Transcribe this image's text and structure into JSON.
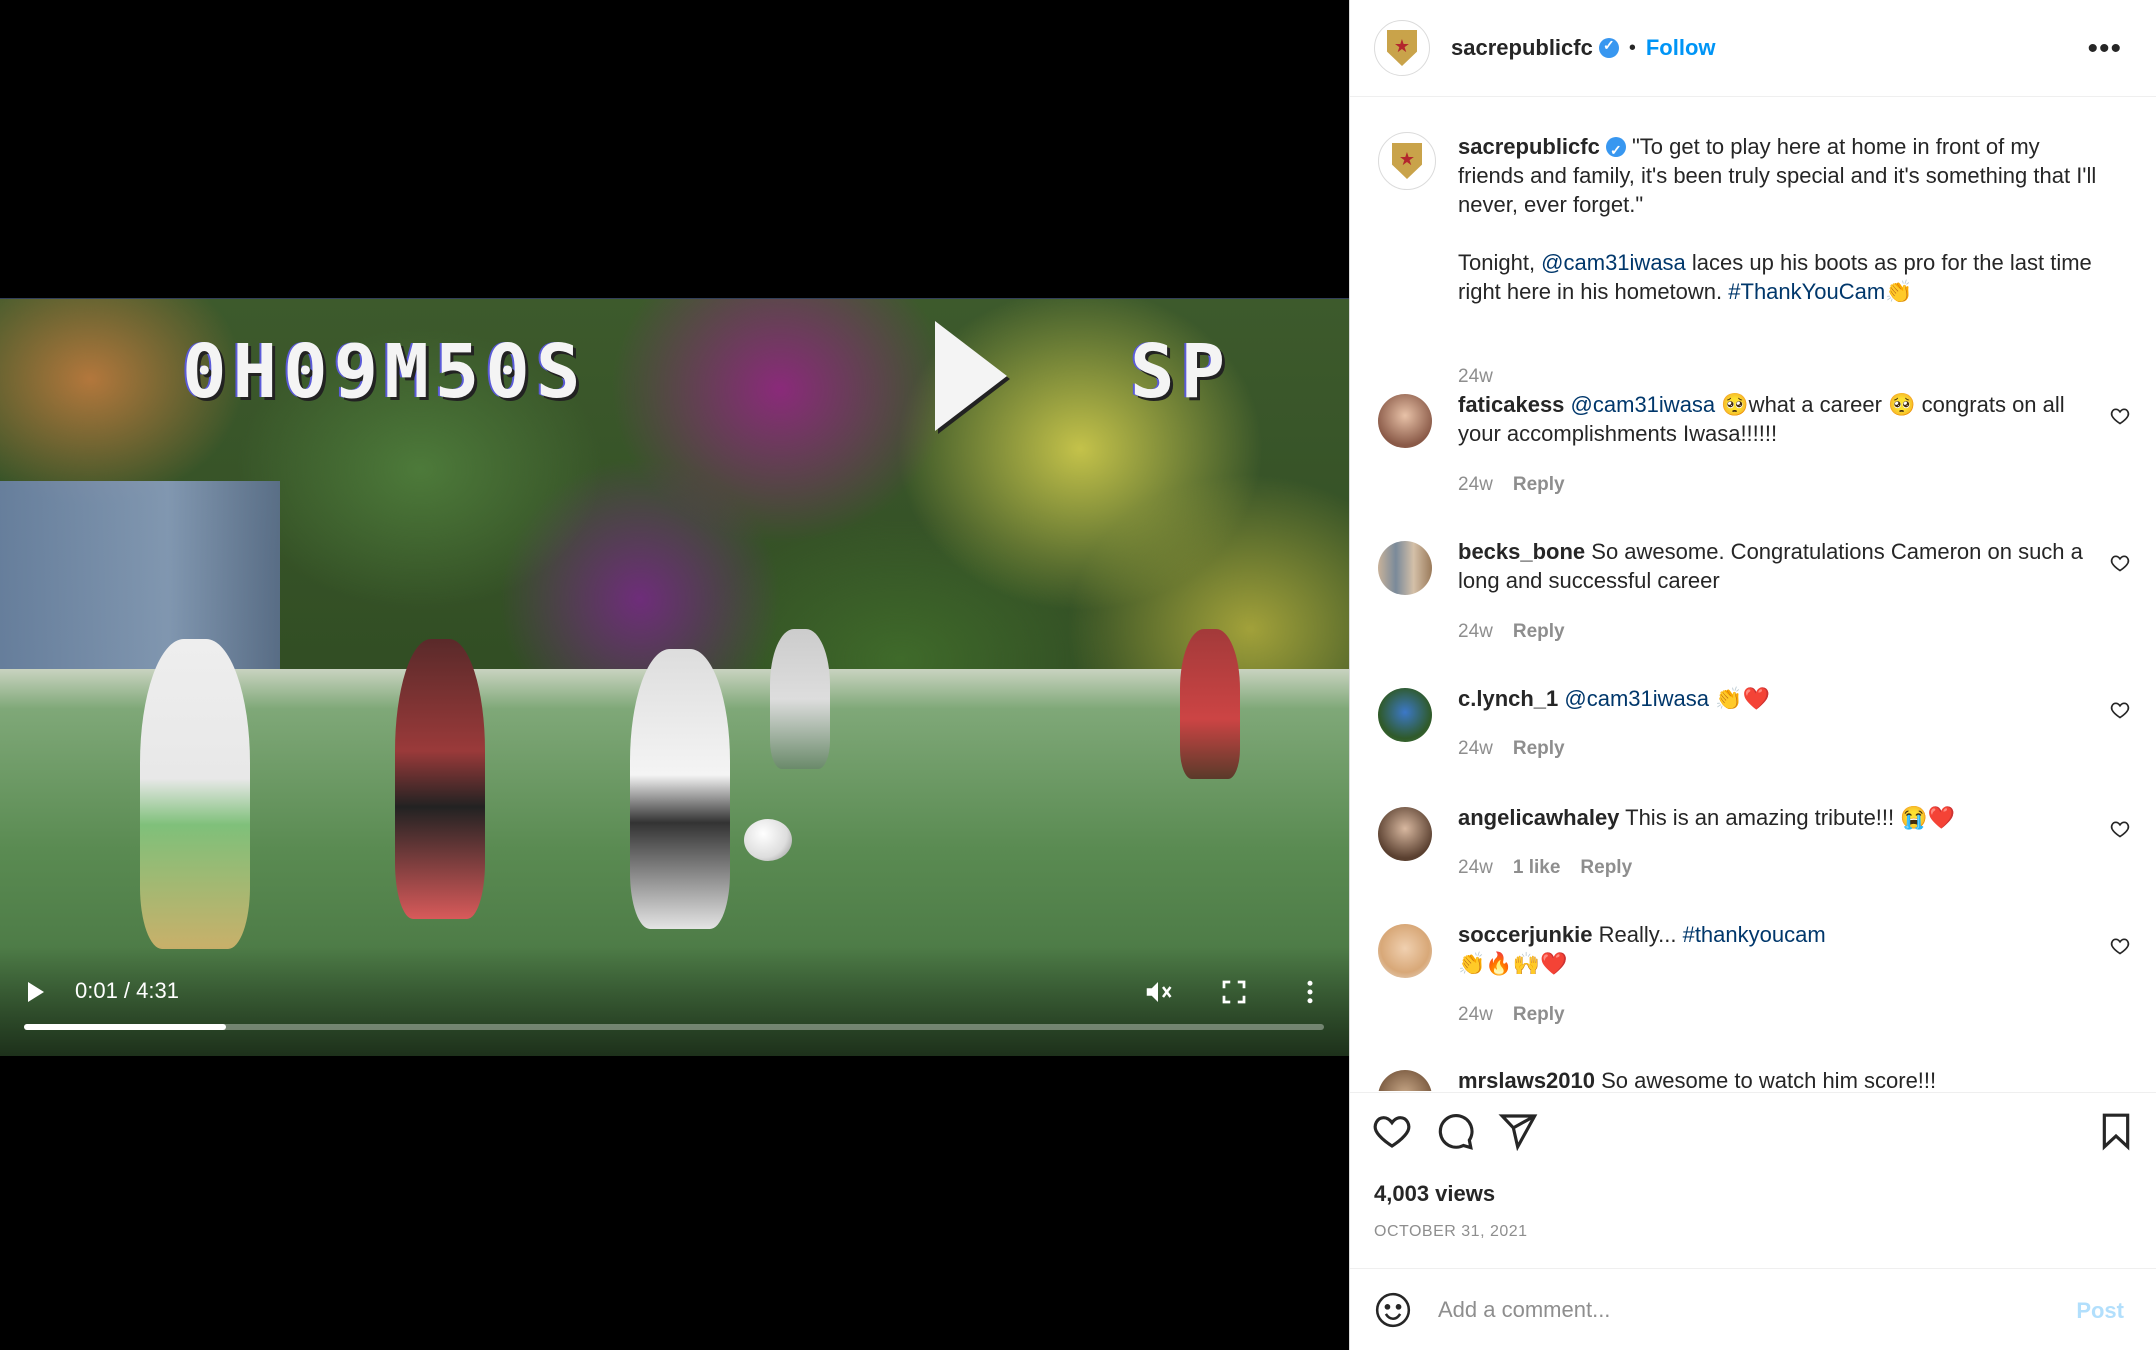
{
  "video": {
    "vhs_time": "0H09M50S",
    "vhs_mode": "SP",
    "time_display": "0:01 / 4:31",
    "progress_fraction": 0.155
  },
  "header": {
    "username": "sacrepublicfc",
    "separator": "•",
    "follow_label": "Follow",
    "more_label": "•••"
  },
  "caption": {
    "username": "sacrepublicfc",
    "text_1": "\"To get to play here at home in front of my friends and family, it's been truly special and it's something that I'll never, ever forget.\"",
    "text_2a": "Tonight, ",
    "mention": "@cam31iwasa",
    "text_2b": " laces up his boots as pro for the last time right here in his hometown. ",
    "hashtag": "#ThankYouCam",
    "emoji": "👏",
    "time": "24w"
  },
  "comments": [
    {
      "username": "faticakess",
      "mention": "@cam31iwasa",
      "text": " 🥺what a career 🥺 congrats on all your accomplishments Iwasa!!!!!!",
      "time": "24w",
      "likes": "",
      "reply": "Reply",
      "avatar_color": "#c79a82"
    },
    {
      "username": "becks_bone",
      "mention": "",
      "text": " So awesome. Congratulations Cameron on such a long and successful career",
      "time": "24w",
      "likes": "",
      "reply": "Reply",
      "avatar_color": "#b5a38c"
    },
    {
      "username": "c.lynch_1",
      "mention": "@cam31iwasa",
      "text": " 👏❤️",
      "time": "24w",
      "likes": "",
      "reply": "Reply",
      "avatar_color": "#3a6a3d"
    },
    {
      "username": "angelicawhaley",
      "mention": "",
      "text": " This is an amazing tribute!!! 😭❤️",
      "time": "24w",
      "likes": "1 like",
      "reply": "Reply",
      "avatar_color": "#8a6a58"
    },
    {
      "username": "soccerjunkie",
      "mention": "",
      "text": " Really... ",
      "hashtag": "#thankyoucam",
      "text2": "👏🔥🙌❤️",
      "time": "24w",
      "likes": "",
      "reply": "Reply",
      "avatar_color": "#d8b38a"
    },
    {
      "username": "mrslaws2010",
      "mention": "",
      "text": " So awesome to watch him score!!!",
      "time": "",
      "likes": "",
      "reply": "",
      "avatar_color": "#a4876a"
    }
  ],
  "actions": {
    "views": "4,003 views",
    "date": "OCTOBER 31, 2021"
  },
  "add_comment": {
    "placeholder": "Add a comment...",
    "post_label": "Post"
  },
  "colors": {
    "accent": "#0095f6",
    "verified": "#3897f0",
    "link": "#00376b",
    "muted": "#8e8e8e"
  }
}
